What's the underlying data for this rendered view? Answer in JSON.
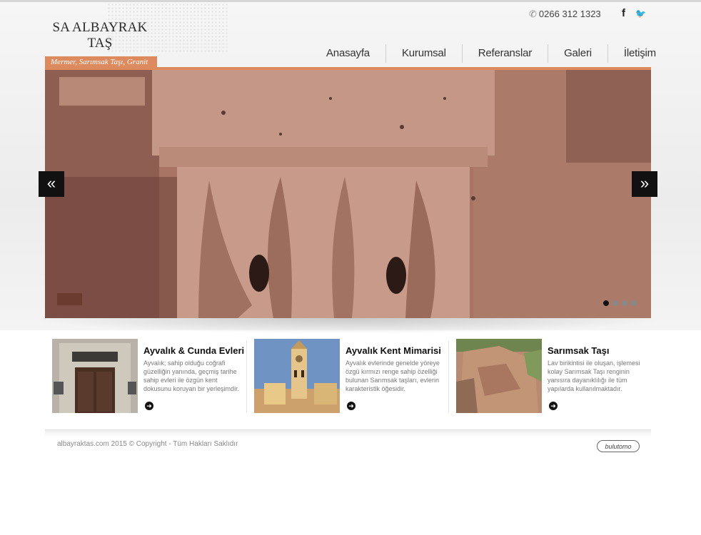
{
  "header": {
    "logo_line1": "SA ALBAYRAK",
    "logo_line2": "TAŞ",
    "tagline": "Mermer, Sarımsak Taşı, Granit",
    "phone": "0266 312 1323",
    "phone_icon": "phone-icon",
    "social": {
      "facebook": "f",
      "twitter": "🐦"
    }
  },
  "nav": {
    "items": [
      "Anasayfa",
      "Kurumsal",
      "Referanslar",
      "Galeri",
      "İletişim"
    ]
  },
  "slider": {
    "prev_icon": "«",
    "next_icon": "»",
    "slide_count": 4,
    "active_slide": 1
  },
  "features": [
    {
      "title": "Ayvalık & Cunda Evleri",
      "desc": "Ayvalık; sahip olduğu coğrafi güzelliğin yanında, geçmiş tarihe sahip evleri ile özgün kent dokusunu koruyan bir yerleşimdir.",
      "more_icon": "➜"
    },
    {
      "title": "Ayvalık Kent Mimarisi",
      "desc": "Ayvalık evlerinde genelde yöreye özgü kırmızı renge sahip özelliği bulunan Sarımsak taşları, evlerin karakteristik öğesidir.",
      "more_icon": "➜"
    },
    {
      "title": "Sarımsak Taşı",
      "desc": "Lav birikintisi ile oluşan, işlemesi kolay Sarımsak Taşı renginin yanısıra dayanıklılığı ile tüm yapılarda kullanılmaktadır.",
      "more_icon": "➜"
    }
  ],
  "footer": {
    "copyright": "albayraktas.com 2015 © Copyright - Tüm Hakları Saklıdır",
    "brand": "bulutomo"
  },
  "colors": {
    "accent": "#dd8a5e",
    "stone": "#a97868"
  }
}
